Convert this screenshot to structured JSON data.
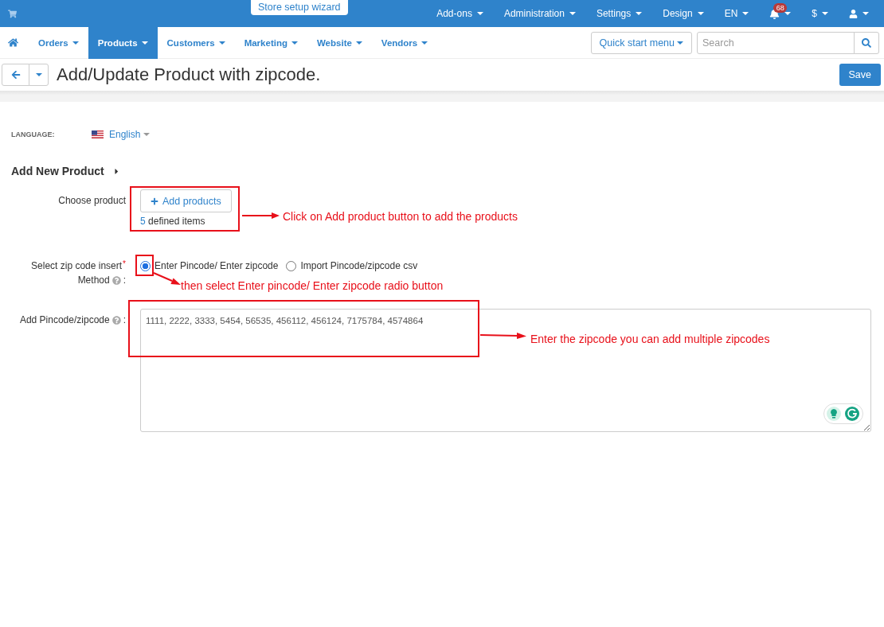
{
  "top_bar": {
    "wizard": "Store setup wizard",
    "menus": [
      {
        "label": "Add-ons"
      },
      {
        "label": "Administration"
      },
      {
        "label": "Settings"
      },
      {
        "label": "Design"
      },
      {
        "label": "EN"
      }
    ],
    "notifications": {
      "count": "68"
    },
    "currency": {
      "label": "$"
    }
  },
  "nav": {
    "items": [
      {
        "label": "Orders",
        "selected": false
      },
      {
        "label": "Products",
        "selected": true
      },
      {
        "label": "Customers",
        "selected": false
      },
      {
        "label": "Marketing",
        "selected": false
      },
      {
        "label": "Website",
        "selected": false
      },
      {
        "label": "Vendors",
        "selected": false
      }
    ],
    "quick_start": "Quick start menu",
    "search": {
      "placeholder": "Search"
    }
  },
  "header": {
    "title": "Add/Update Product with zipcode.",
    "save": "Save"
  },
  "language": {
    "label": "LANGUAGE:",
    "value": "English"
  },
  "section": {
    "title": "Add New Product"
  },
  "form": {
    "choose_product": {
      "label": "Choose product",
      "button": "Add products",
      "count": "5",
      "count_label": "defined items"
    },
    "method": {
      "label": "Select zip code insert",
      "required_mark": "*",
      "label_line2": "Method",
      "label_suffix": ":",
      "options": [
        {
          "label": "Enter Pincode/ Enter zipcode",
          "selected": true
        },
        {
          "label": "Import Pincode/zipcode csv",
          "selected": false
        }
      ]
    },
    "zipcodes": {
      "label": "Add Pincode/zipcode",
      "label_suffix": ":",
      "value": "1111, 2222, 3333, 5454, 56535, 456112, 456124, 7175784, 4574864"
    }
  },
  "annotations": [
    {
      "text": "Click on Add product button to add the products"
    },
    {
      "text": "then select Enter pincode/ Enter zipcode radio button"
    },
    {
      "text": "Enter the zipcode you can add multiple zipcodes"
    }
  ]
}
